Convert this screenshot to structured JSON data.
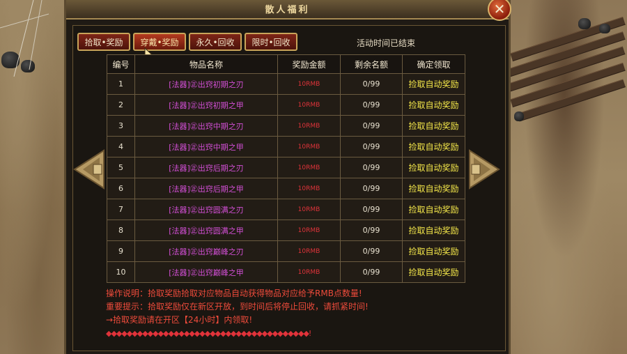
{
  "window": {
    "title": "散人福利"
  },
  "tabs": [
    {
      "label": "拾取•奖励",
      "active": false
    },
    {
      "label": "穿戴•奖励",
      "active": true
    },
    {
      "label": "永久•回收",
      "active": false
    },
    {
      "label": "限时•回收",
      "active": false
    }
  ],
  "status": "活动时间已结束",
  "table": {
    "headers": [
      "编号",
      "物品名称",
      "奖励金额",
      "剩余名额",
      "确定领取"
    ],
    "rows": [
      {
        "id": "1",
        "name": "[法器]㊣出窍初期之刃",
        "amount": "10RMB",
        "remaining": "0/99",
        "action": "捡取自动奖励"
      },
      {
        "id": "2",
        "name": "[法器]㊣出窍初期之甲",
        "amount": "10RMB",
        "remaining": "0/99",
        "action": "捡取自动奖励"
      },
      {
        "id": "3",
        "name": "[法器]㊣出窍中期之刃",
        "amount": "10RMB",
        "remaining": "0/99",
        "action": "捡取自动奖励"
      },
      {
        "id": "4",
        "name": "[法器]㊣出窍中期之甲",
        "amount": "10RMB",
        "remaining": "0/99",
        "action": "捡取自动奖励"
      },
      {
        "id": "5",
        "name": "[法器]㊣出窍后期之刃",
        "amount": "10RMB",
        "remaining": "0/99",
        "action": "捡取自动奖励"
      },
      {
        "id": "6",
        "name": "[法器]㊣出窍后期之甲",
        "amount": "10RMB",
        "remaining": "0/99",
        "action": "捡取自动奖励"
      },
      {
        "id": "7",
        "name": "[法器]㊣出窍圆满之刃",
        "amount": "10RMB",
        "remaining": "0/99",
        "action": "捡取自动奖励"
      },
      {
        "id": "8",
        "name": "[法器]㊣出窍圆满之甲",
        "amount": "10RMB",
        "remaining": "0/99",
        "action": "捡取自动奖励"
      },
      {
        "id": "9",
        "name": "[法器]㊣出窍巅峰之刃",
        "amount": "10RMB",
        "remaining": "0/99",
        "action": "捡取自动奖励"
      },
      {
        "id": "10",
        "name": "[法器]㊣出窍巅峰之甲",
        "amount": "10RMB",
        "remaining": "0/99",
        "action": "捡取自动奖励"
      }
    ]
  },
  "notes": {
    "line1": "操作说明：拾取奖励拾取对应物品自动获得物品对应给予RMB点数量!",
    "line2": "重要提示：拾取奖励仅在新区开放，到时间后将停止回收，请抓紧时间!",
    "line3": "→拾取奖励请在开区【24小时】内领取!",
    "line4": "◆◆◆◆◆◆◆◆◆◆◆◆◆◆◆◆◆◆◆◆◆◆◆◆◆◆◆◆◆◆◆◆◆◆◆◆◆◆◆!"
  },
  "colors": {
    "item": "#d34fd6",
    "amount": "#e0333a",
    "claim": "#f5e84a",
    "notes": "#ee4b3b",
    "border": "#c9a55a"
  },
  "icons": {
    "close": "close-icon",
    "prev": "arrow-left-icon",
    "next": "arrow-right-icon"
  }
}
